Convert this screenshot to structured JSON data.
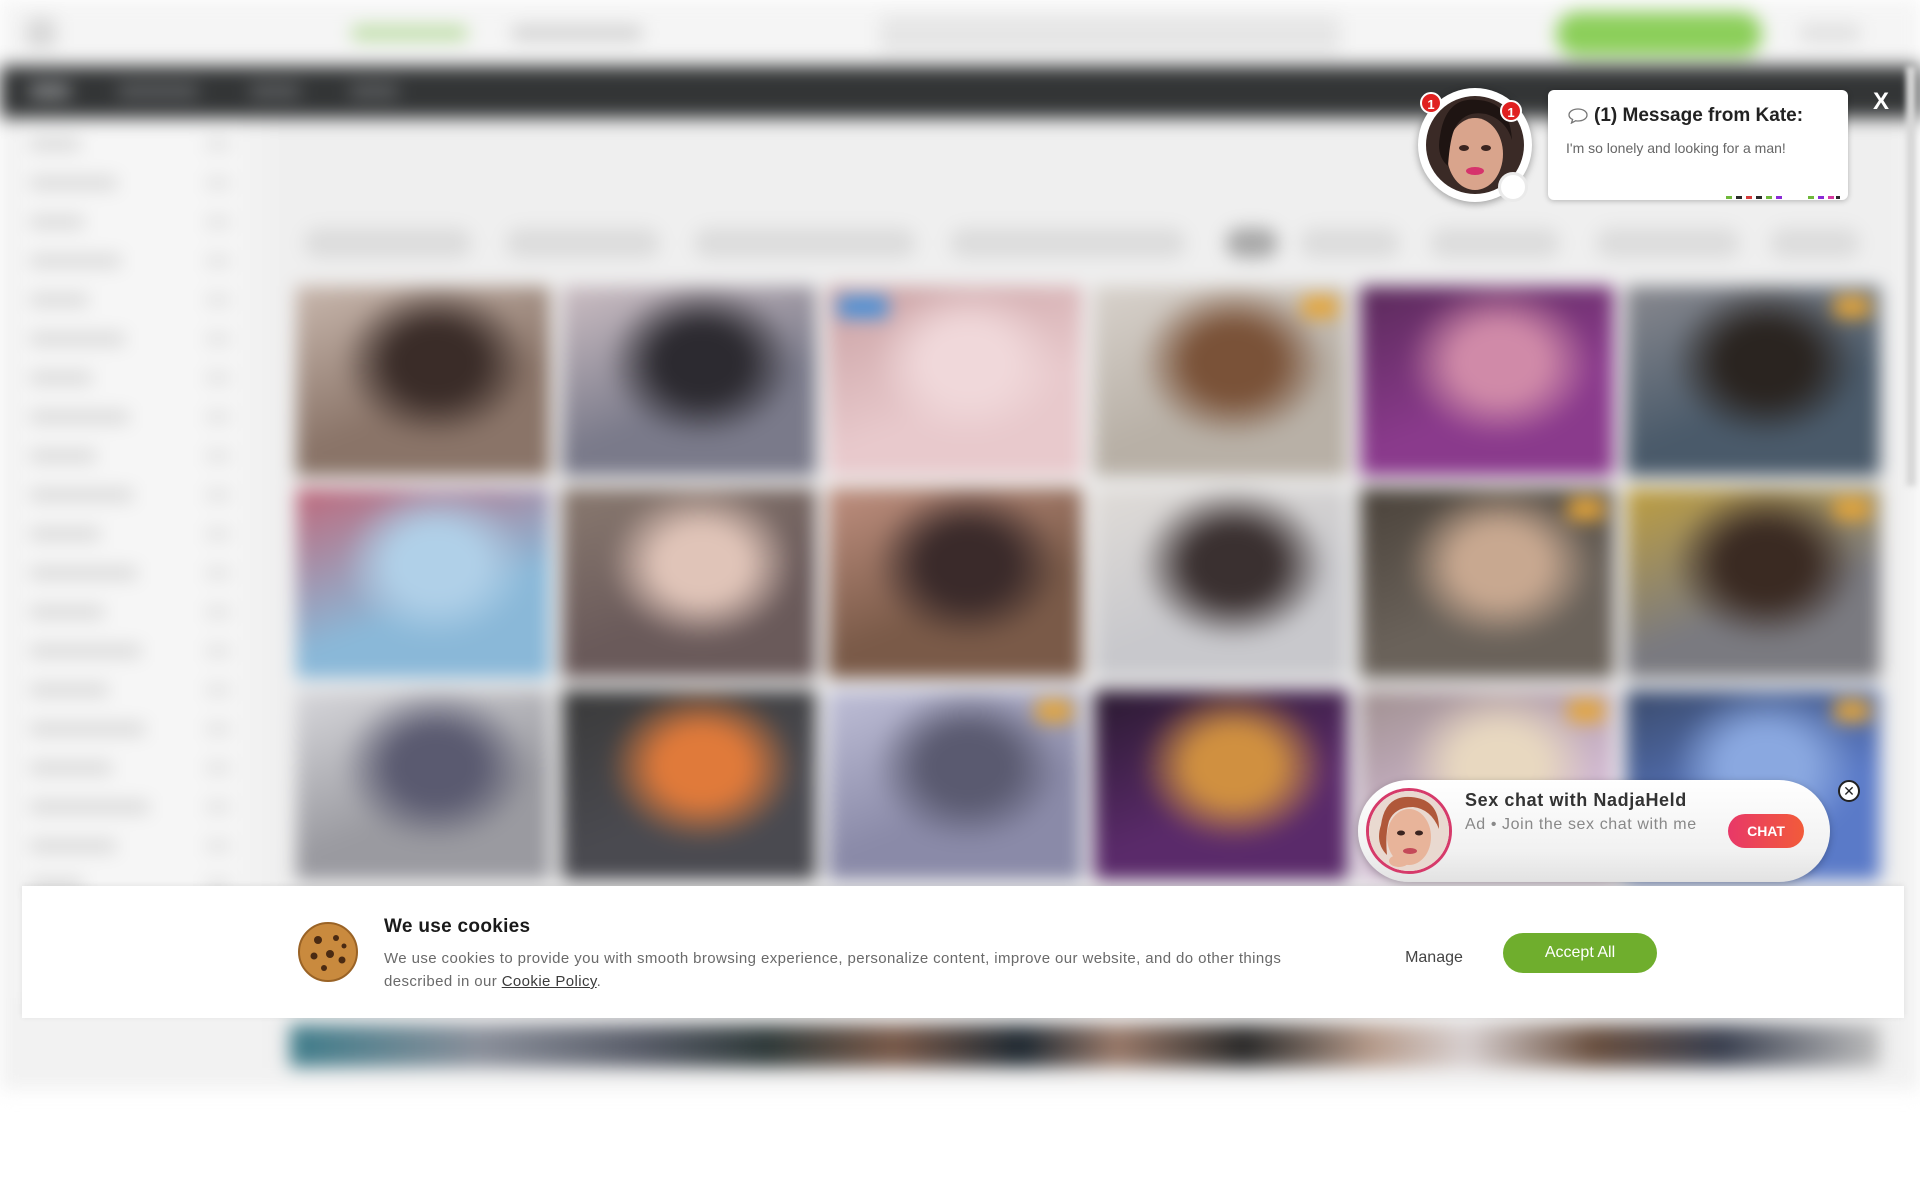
{
  "message_popup": {
    "title": "(1) Message from Kate:",
    "text": "I'm so lonely and looking for a man!",
    "avatar_badge_count": "1",
    "avatar_badge_count_secondary": "1",
    "close_label": "X",
    "chat_icon": "speech-bubble-icon"
  },
  "ad_chat": {
    "title": "Sex chat with NadjaHeld",
    "subtitle": "Ad • Join the sex chat with me",
    "button_label": "CHAT",
    "close_label": "✕"
  },
  "cookie_banner": {
    "title": "We use cookies",
    "text": "We use cookies to provide you with smooth browsing experience, personalize content, improve our website, and do other things described in our ",
    "link_text": "Cookie Policy",
    "text_end": ".",
    "manage_label": "Manage",
    "accept_label": "Accept All",
    "icon": "cookie-icon"
  },
  "colors": {
    "accent_green": "#6fae2d",
    "chat_button_gradient": [
      "#e83868",
      "#f25b3a"
    ],
    "notification_red": "#e02020",
    "navbar": "#333536"
  }
}
